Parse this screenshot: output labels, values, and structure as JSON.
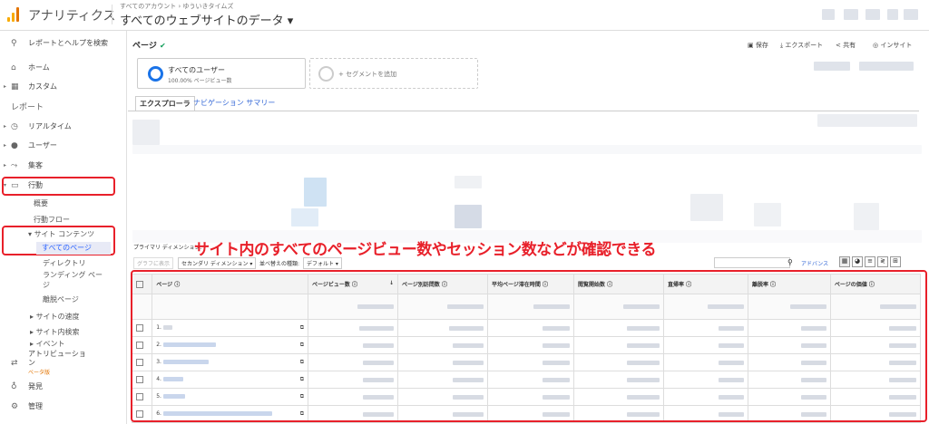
{
  "header": {
    "app_name": "アナリティクス",
    "breadcrumb": "すべてのアカウント › ゆういきタイムズ",
    "view_name": "すべてのウェブサイトのデータ ▾"
  },
  "sidebar": {
    "search": "レポートとヘルプを検索",
    "home": "ホーム",
    "custom": "カスタム",
    "reports_heading": "レポート",
    "realtime": "リアルタイム",
    "user": "ユーザー",
    "acquisition": "集客",
    "behavior": "行動",
    "overview": "概要",
    "behavior_flow": "行動フロー",
    "site_content": "サイト コンテンツ",
    "all_pages": "すべてのページ",
    "directory": "ディレクトリ",
    "landing_pages_1": "ランディング ペー",
    "landing_pages_2": "ジ",
    "exit_pages": "離脱ページ",
    "site_speed": "サイトの速度",
    "site_search": "サイト内検索",
    "events": "イベント",
    "attribution_1": "アトリビューショ",
    "attribution_2": "ン",
    "beta": "ベータ版",
    "discover": "発見",
    "admin": "管理"
  },
  "main": {
    "page_title": "ページ",
    "toolbar": {
      "save": "保存",
      "export": "エクスポート",
      "share": "共有",
      "insight": "インサイト"
    },
    "segment_all_users": "すべてのユーザー",
    "segment_pct": "100.00% ページビュー数",
    "segment_add": "+ セグメントを追加",
    "tab_explorer": "エクスプローラ",
    "tab_nav_summary": "ナビゲーション サマリー",
    "primary_dimension": "プライマリ ディメンション:",
    "graph_btn": "グラフに表示",
    "secondary_dimension": "セカンダリ ディメンション ▾",
    "sort_type": "並べ替えの種類:",
    "sort_default": "デフォルト ▾",
    "advanced": "アドバンス",
    "annotation": "サイト内のすべてのページビュー数やセッション数などが確認できる"
  },
  "table": {
    "columns": [
      "ページ",
      "ページビュー数",
      "ページ別訪問数",
      "平均ページ滞在時間",
      "閲覧開始数",
      "直帰率",
      "離脱率",
      "ページの価値"
    ],
    "rows": [
      "1.",
      "2.",
      "3.",
      "4.",
      "5.",
      "6."
    ]
  },
  "colors": {
    "accent": "#e8202a",
    "link": "#3367d6",
    "ga_orange": "#f9ab00"
  }
}
